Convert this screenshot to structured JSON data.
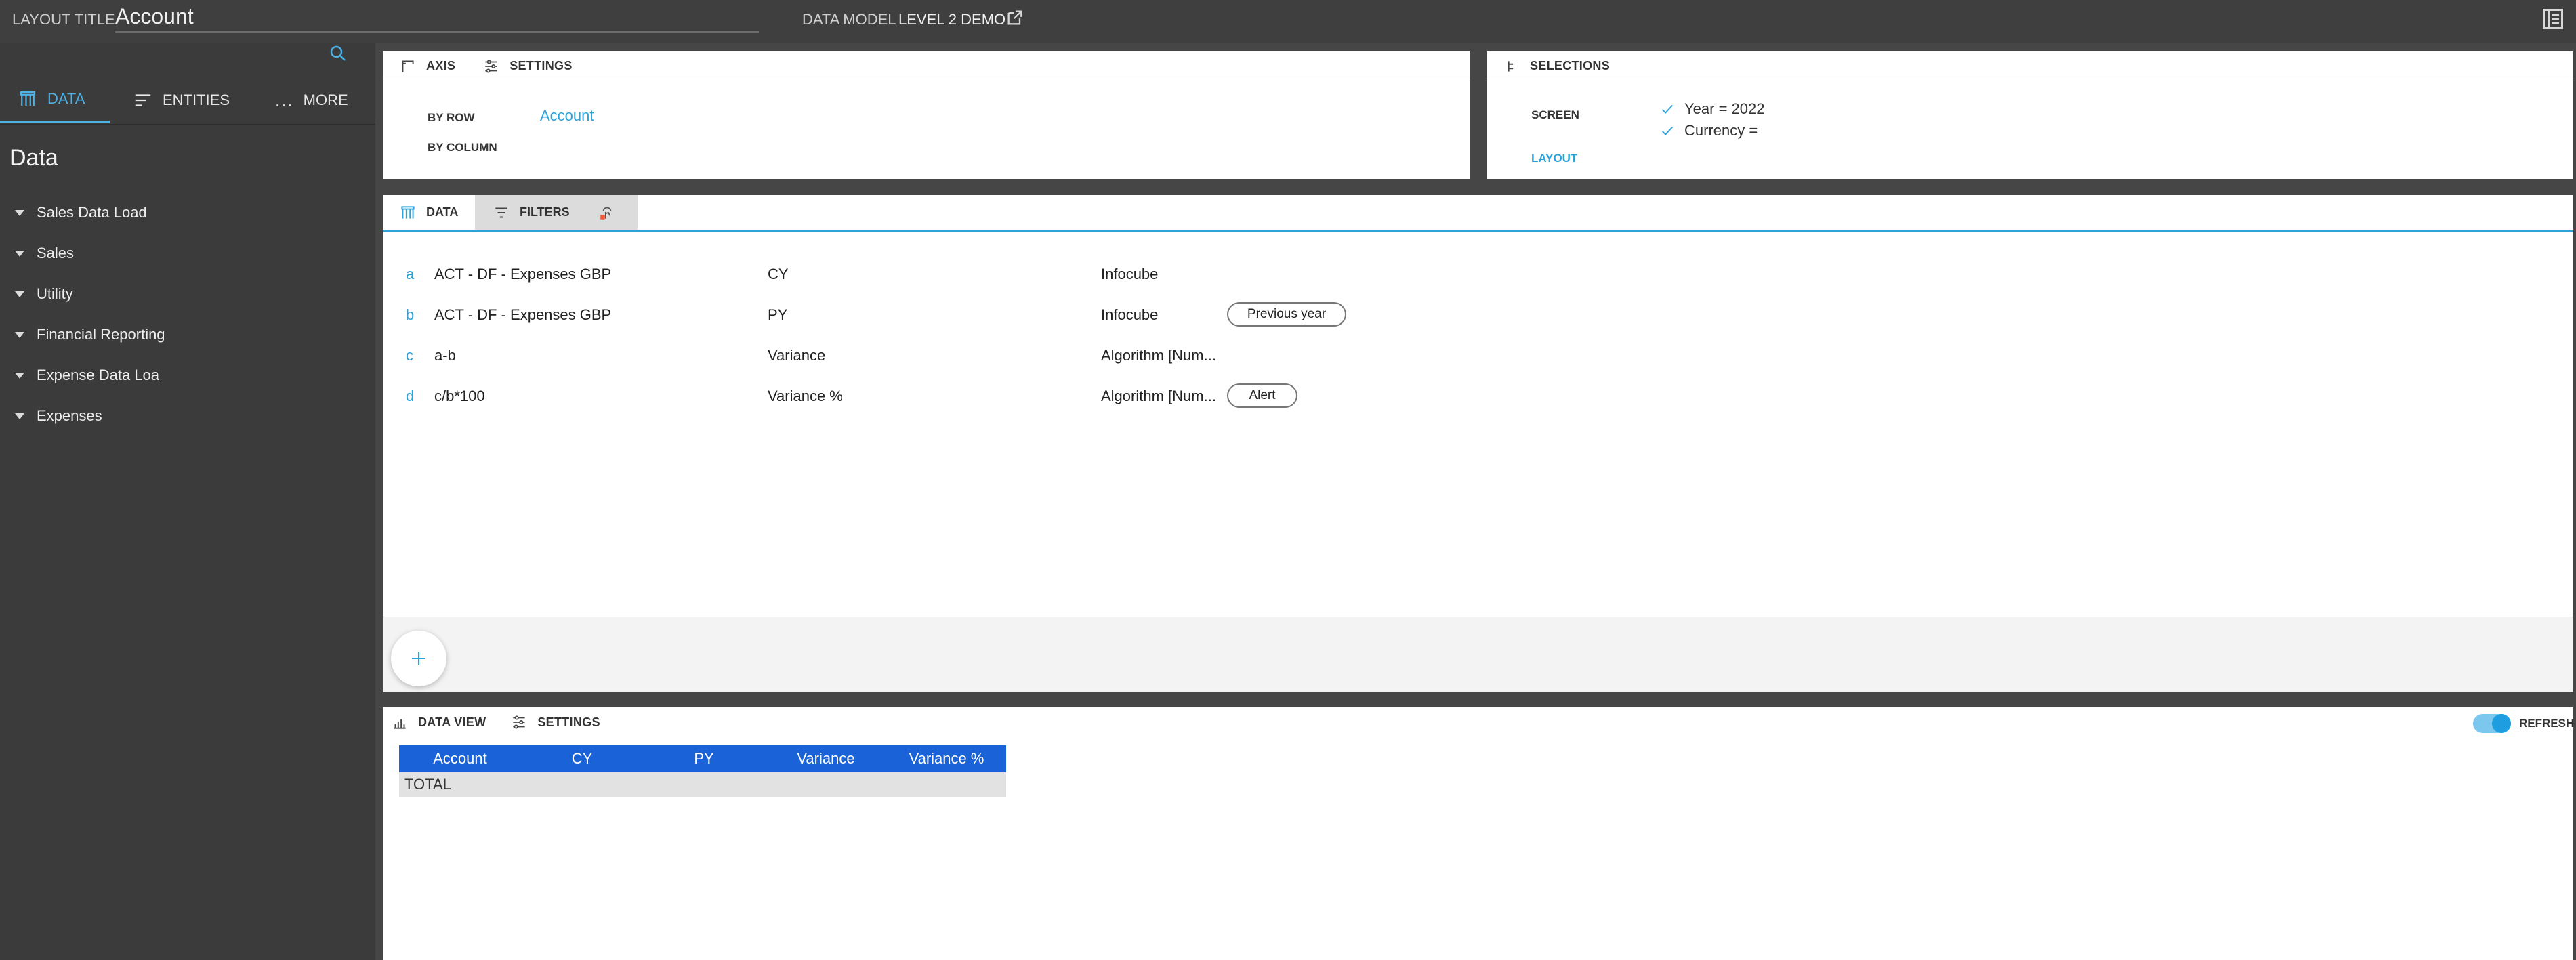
{
  "topbar": {
    "layout_title_label": "LAYOUT TITLE",
    "layout_title_value": "Account",
    "data_model_label": "DATA MODEL",
    "data_model_value": "LEVEL 2 DEMO"
  },
  "sidebar": {
    "tabs": [
      {
        "label": "DATA",
        "icon": "data-columns-icon",
        "active": true
      },
      {
        "label": "ENTITIES",
        "icon": "list-lines-icon",
        "active": false
      },
      {
        "label": "MORE",
        "icon": "more-dots-icon",
        "active": false
      }
    ],
    "title": "Data",
    "items": [
      {
        "label": "Sales Data Load"
      },
      {
        "label": "Sales"
      },
      {
        "label": "Utility"
      },
      {
        "label": "Financial Reporting"
      },
      {
        "label": "Expense Data Loa"
      },
      {
        "label": "Expenses"
      }
    ]
  },
  "axis_panel": {
    "tabs": [
      {
        "label": "AXIS",
        "icon": "axis-icon"
      },
      {
        "label": "SETTINGS",
        "icon": "sliders-icon"
      }
    ],
    "by_row_label": "BY ROW",
    "by_row_value": "Account",
    "by_column_label": "BY COLUMN",
    "by_column_value": ""
  },
  "selections_panel": {
    "title": "SELECTIONS",
    "screen_label": "SCREEN",
    "layout_label": "LAYOUT",
    "items": [
      {
        "label": "Year = 2022"
      },
      {
        "label": "Currency ="
      }
    ]
  },
  "data_panel": {
    "tabs": [
      {
        "label": "DATA",
        "icon": "data-columns-icon"
      },
      {
        "label": "FILTERS",
        "icon": "filter-icon"
      },
      {
        "label": "",
        "icon": "touch-alert-icon"
      }
    ],
    "rows": [
      {
        "letter": "a",
        "formula": "ACT - DF - Expenses GBP",
        "name": "CY",
        "source": "Infocube",
        "pill": ""
      },
      {
        "letter": "b",
        "formula": "ACT - DF - Expenses GBP",
        "name": "PY",
        "source": "Infocube",
        "pill": "Previous year"
      },
      {
        "letter": "c",
        "formula": "a-b",
        "name": "Variance",
        "source": "Algorithm [Num...",
        "pill": ""
      },
      {
        "letter": "d",
        "formula": "c/b*100",
        "name": "Variance %",
        "source": "Algorithm [Num...",
        "pill": "Alert"
      }
    ],
    "add_icon": "plus-icon"
  },
  "data_view_panel": {
    "tabs": [
      {
        "label": "DATA VIEW",
        "icon": "bar-chart-icon"
      },
      {
        "label": "SETTINGS",
        "icon": "sliders-icon"
      }
    ],
    "refresh_label": "REFRESH",
    "refresh_on": true,
    "table": {
      "headers": [
        "Account",
        "CY",
        "PY",
        "Variance",
        "Variance %"
      ],
      "rows": [
        [
          "TOTAL",
          "",
          "",
          "",
          ""
        ]
      ]
    }
  },
  "colors": {
    "accent": "#2aa3dc",
    "table_header": "#1a62d8",
    "sidebar_bg": "#3b3b3b"
  }
}
